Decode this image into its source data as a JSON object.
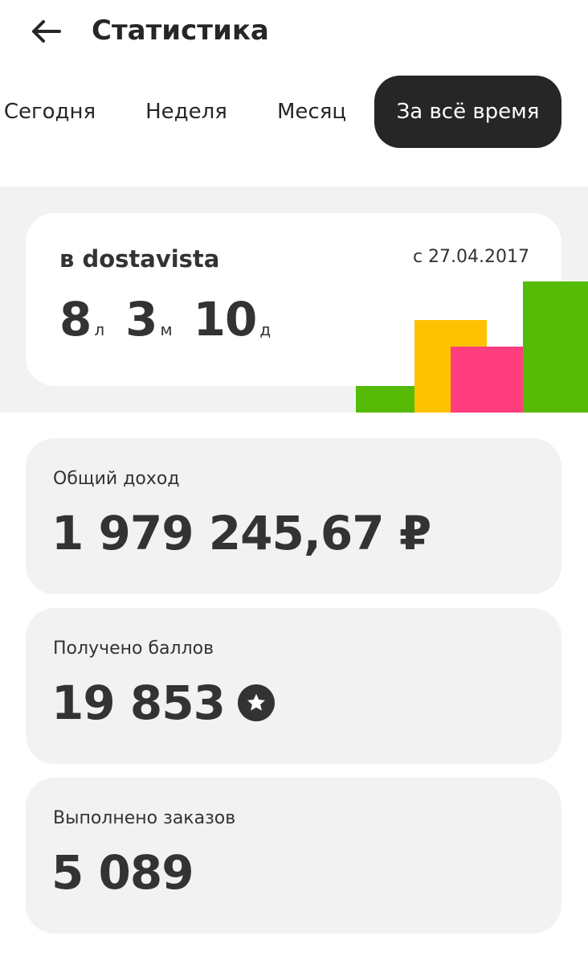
{
  "header": {
    "back_icon": "arrow-left-icon",
    "title": "Статистика"
  },
  "tabs": [
    {
      "label": "Сегодня",
      "active": false
    },
    {
      "label": "Неделя",
      "active": false
    },
    {
      "label": "Месяц",
      "active": false
    },
    {
      "label": "За всё время",
      "active": true
    }
  ],
  "summary": {
    "company": "в dostavista",
    "since": "с 27.04.2017",
    "years": "8",
    "years_unit": "л",
    "months": "3",
    "months_unit": "м",
    "days": "10",
    "days_unit": "д",
    "decor_colors": [
      "#55bb06",
      "#ffc200",
      "#ff3e7f"
    ]
  },
  "stats": {
    "income": {
      "label": "Общий доход",
      "value": "1 979 245,67 ₽"
    },
    "points": {
      "label": "Получено баллов",
      "value": "19 853",
      "icon": "star-badge-icon"
    },
    "orders": {
      "label": "Выполнено заказов",
      "value": "5 089"
    }
  },
  "colors": {
    "dark": "#262626",
    "text": "#333333",
    "card_bg": "#f2f2f2"
  }
}
